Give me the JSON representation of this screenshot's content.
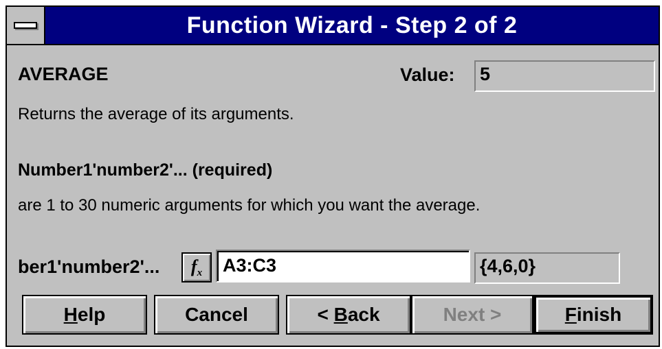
{
  "window": {
    "title": "Function Wizard - Step 2 of 2"
  },
  "function": {
    "name": "AVERAGE",
    "value_label": "Value:",
    "value": "5",
    "description": "Returns the average of its arguments."
  },
  "argument": {
    "name": "Number1'number2'... (required)",
    "description": "are 1 to 30 numeric arguments for which you want the average.",
    "field_label": "ber1'number2'...",
    "input_value": "A3:C3",
    "result": "{4,6,0}"
  },
  "buttons": {
    "help": {
      "mnemonic": "H",
      "rest": "elp"
    },
    "cancel": "Cancel",
    "back": {
      "prefix": "< ",
      "mnemonic": "B",
      "rest": "ack"
    },
    "next": "Next >",
    "finish": {
      "mnemonic": "F",
      "rest": "inish"
    }
  },
  "icons": {
    "system_menu": "system-menu-icon",
    "function_button": "fx-icon"
  }
}
